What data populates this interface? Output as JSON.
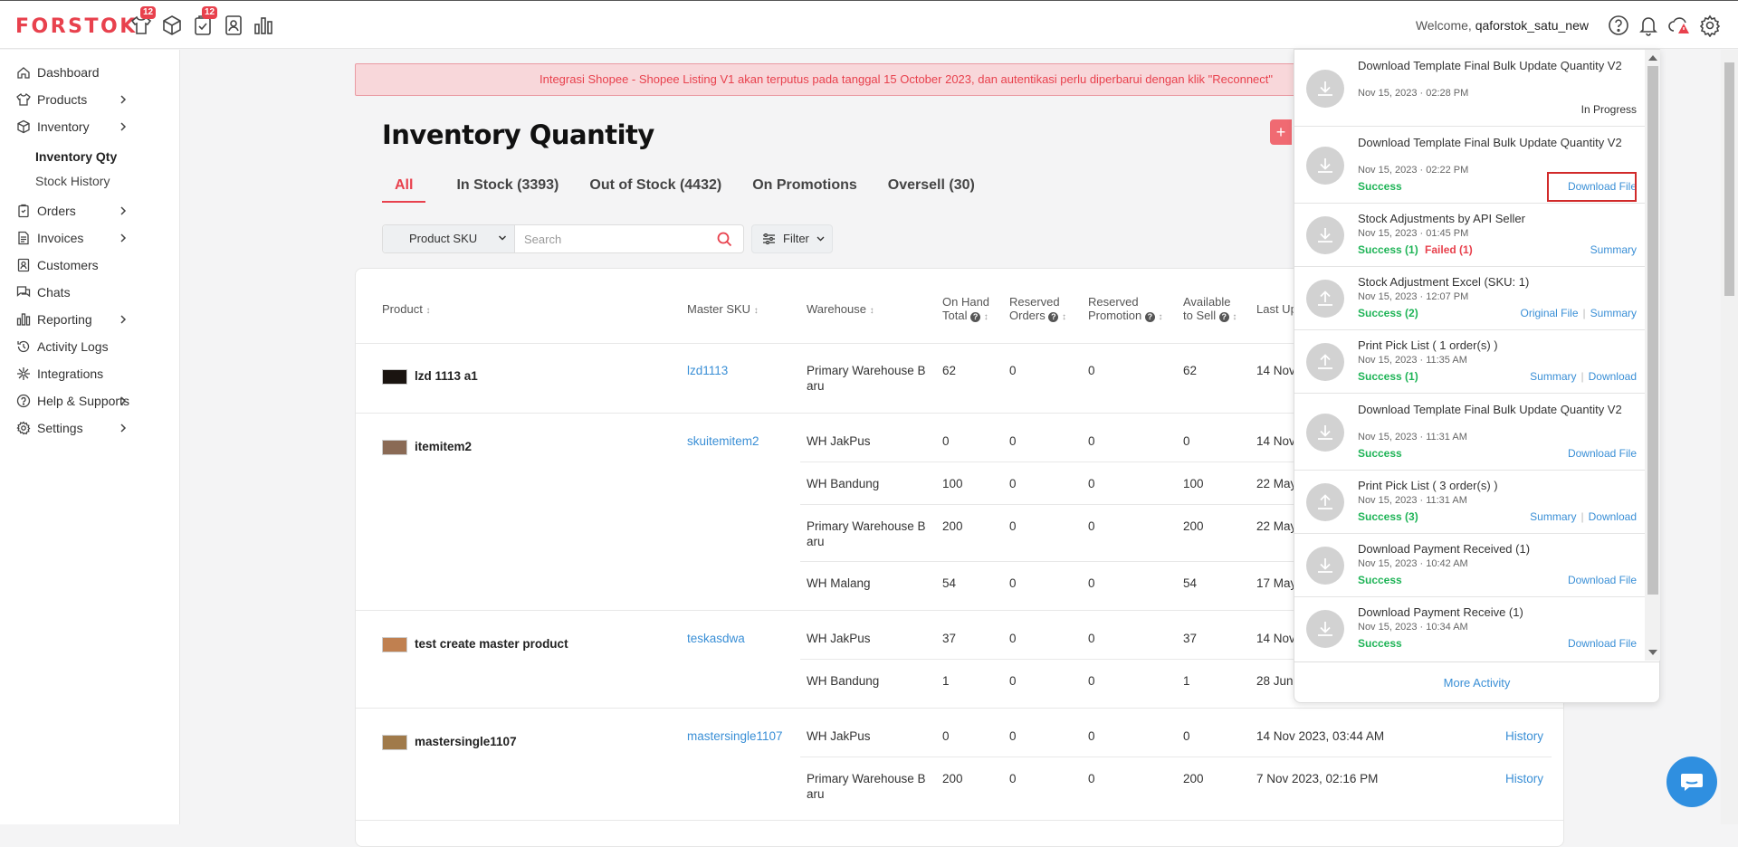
{
  "header": {
    "logo": "FORSTOK",
    "badge_products": "12",
    "badge_orders": "12",
    "welcome_prefix": "Welcome,",
    "username": "qaforstok_satu_new",
    "icons": [
      "shirt-icon",
      "box-icon",
      "clipboard-check-icon",
      "contact-icon",
      "bar-chart-icon",
      "help-icon",
      "bell-icon",
      "cloud-alert-icon",
      "gear-icon"
    ]
  },
  "sidebar": {
    "items": [
      {
        "label": "Dashboard",
        "icon": "home-icon"
      },
      {
        "label": "Products",
        "icon": "shirt-icon"
      },
      {
        "label": "Inventory",
        "icon": "box-icon"
      },
      {
        "label": "Orders",
        "icon": "clipboard-icon"
      },
      {
        "label": "Invoices",
        "icon": "invoice-icon"
      },
      {
        "label": "Customers",
        "icon": "contact-icon"
      },
      {
        "label": "Chats",
        "icon": "chat-icon"
      },
      {
        "label": "Reporting",
        "icon": "bar-chart-icon"
      },
      {
        "label": "Activity Logs",
        "icon": "history-icon"
      },
      {
        "label": "Integrations",
        "icon": "integration-icon"
      },
      {
        "label": "Help & Supports",
        "icon": "help-icon"
      },
      {
        "label": "Settings",
        "icon": "gear-icon"
      }
    ],
    "sub_inventory": [
      "Inventory Qty",
      "Stock History"
    ]
  },
  "alert": "Integrasi Shopee - Shopee Listing V1 akan terputus pada tanggal 15 October 2023, dan autentikasi perlu diperbarui dengan klik \"Reconnect\"",
  "page": {
    "title": "Inventory Quantity",
    "add_button": "+",
    "tabs": [
      "All",
      "In Stock (3393)",
      "Out of Stock (4432)",
      "On Promotions",
      "Oversell (30)"
    ],
    "search_select": "Product SKU",
    "search_placeholder": "Search",
    "filter_label": "Filter"
  },
  "table": {
    "headers": {
      "product": "Product",
      "master_sku": "Master SKU",
      "warehouse": "Warehouse",
      "on_hand_1": "On Hand",
      "on_hand_2": "Total",
      "reserved_orders_1": "Reserved",
      "reserved_orders_2": "Orders",
      "reserved_promo_1": "Reserved",
      "reserved_promo_2": "Promotion",
      "available_1": "Available",
      "available_2": "to Sell",
      "last_updated": "Last Up"
    },
    "sort_glyph": "↕",
    "help_glyph": "?",
    "products": [
      {
        "name": "lzd 1113 a1",
        "sku": "lzd1113",
        "rows": [
          {
            "warehouse": "Primary Warehouse B",
            "warehouse2": "aru",
            "on_hand": "62",
            "res_orders": "0",
            "res_promo": "0",
            "available": "62",
            "updated": "14 Nov",
            "action": ""
          }
        ]
      },
      {
        "name": "itemitem2",
        "sku": "skuitemitem2",
        "rows": [
          {
            "warehouse": "WH JakPus",
            "warehouse2": "",
            "on_hand": "0",
            "res_orders": "0",
            "res_promo": "0",
            "available": "0",
            "updated": "14 Nov",
            "action": ""
          },
          {
            "warehouse": "WH Bandung",
            "warehouse2": "",
            "on_hand": "100",
            "res_orders": "0",
            "res_promo": "0",
            "available": "100",
            "updated": "22 May",
            "action": ""
          },
          {
            "warehouse": "Primary Warehouse B",
            "warehouse2": "aru",
            "on_hand": "200",
            "res_orders": "0",
            "res_promo": "0",
            "available": "200",
            "updated": "22 May",
            "action": ""
          },
          {
            "warehouse": "WH Malang",
            "warehouse2": "",
            "on_hand": "54",
            "res_orders": "0",
            "res_promo": "0",
            "available": "54",
            "updated": "17 May",
            "action": ""
          }
        ]
      },
      {
        "name": "test create master product",
        "sku": "teskasdwa",
        "rows": [
          {
            "warehouse": "WH JakPus",
            "warehouse2": "",
            "on_hand": "37",
            "res_orders": "0",
            "res_promo": "0",
            "available": "37",
            "updated": "14 Nov",
            "action": ""
          },
          {
            "warehouse": "WH Bandung",
            "warehouse2": "",
            "on_hand": "1",
            "res_orders": "0",
            "res_promo": "0",
            "available": "1",
            "updated": "28 Jun",
            "action": ""
          }
        ]
      },
      {
        "name": "mastersingle1107",
        "sku": "mastersingle1107",
        "rows": [
          {
            "warehouse": "WH JakPus",
            "warehouse2": "",
            "on_hand": "0",
            "res_orders": "0",
            "res_promo": "0",
            "available": "0",
            "updated": "14 Nov 2023, 03:44 AM",
            "action": "History"
          },
          {
            "warehouse": "Primary Warehouse B",
            "warehouse2": "aru",
            "on_hand": "200",
            "res_orders": "0",
            "res_promo": "0",
            "available": "200",
            "updated": "7 Nov 2023, 02:16 PM",
            "action": "History"
          }
        ]
      }
    ]
  },
  "activity": {
    "items": [
      {
        "title": "Download Template Final Bulk Update Quantity V2",
        "date": "Nov 15, 2023 · 02:28 PM",
        "status": "",
        "status2": "",
        "right": "In Progress",
        "right2": "",
        "icon": "download-icon"
      },
      {
        "title": "Download Template Final Bulk Update Quantity V2",
        "date": "Nov 15, 2023 · 02:22 PM",
        "status": "Success",
        "status2": "",
        "right": "Download File",
        "right2": "",
        "icon": "download-icon"
      },
      {
        "title": "Stock Adjustments by API Seller",
        "date": "Nov 15, 2023 · 01:45 PM",
        "status": "Success (1)",
        "status2": "Failed (1)",
        "right": "Summary",
        "right2": "",
        "icon": "download-icon"
      },
      {
        "title": "Stock Adjustment Excel (SKU: 1)",
        "date": "Nov 15, 2023 · 12:07 PM",
        "status": "Success (2)",
        "status2": "",
        "right": "Original File",
        "right2": "Summary",
        "icon": "upload-icon"
      },
      {
        "title": "Print Pick List ( 1 order(s) )",
        "date": "Nov 15, 2023 · 11:35 AM",
        "status": "Success (1)",
        "status2": "",
        "right": "Summary",
        "right2": "Download",
        "icon": "upload-icon"
      },
      {
        "title": "Download Template Final Bulk Update Quantity V2",
        "date": "Nov 15, 2023 · 11:31 AM",
        "status": "Success",
        "status2": "",
        "right": "Download File",
        "right2": "",
        "icon": "download-icon"
      },
      {
        "title": "Print Pick List ( 3 order(s) )",
        "date": "Nov 15, 2023 · 11:31 AM",
        "status": "Success (3)",
        "status2": "",
        "right": "Summary",
        "right2": "Download",
        "icon": "upload-icon"
      },
      {
        "title": "Download Payment Received (1)",
        "date": "Nov 15, 2023 · 10:42 AM",
        "status": "Success",
        "status2": "",
        "right": "Download File",
        "right2": "",
        "icon": "download-icon"
      },
      {
        "title": "Download Payment Receive (1)",
        "date": "Nov 15, 2023 · 10:34 AM",
        "status": "Success",
        "status2": "",
        "right": "Download File",
        "right2": "",
        "icon": "download-icon"
      }
    ],
    "more": "More Activity"
  },
  "colors": {
    "brand": "#e8414d",
    "link": "#3a8fd6",
    "success": "#1fb457",
    "highlight": "#d12a2a"
  }
}
